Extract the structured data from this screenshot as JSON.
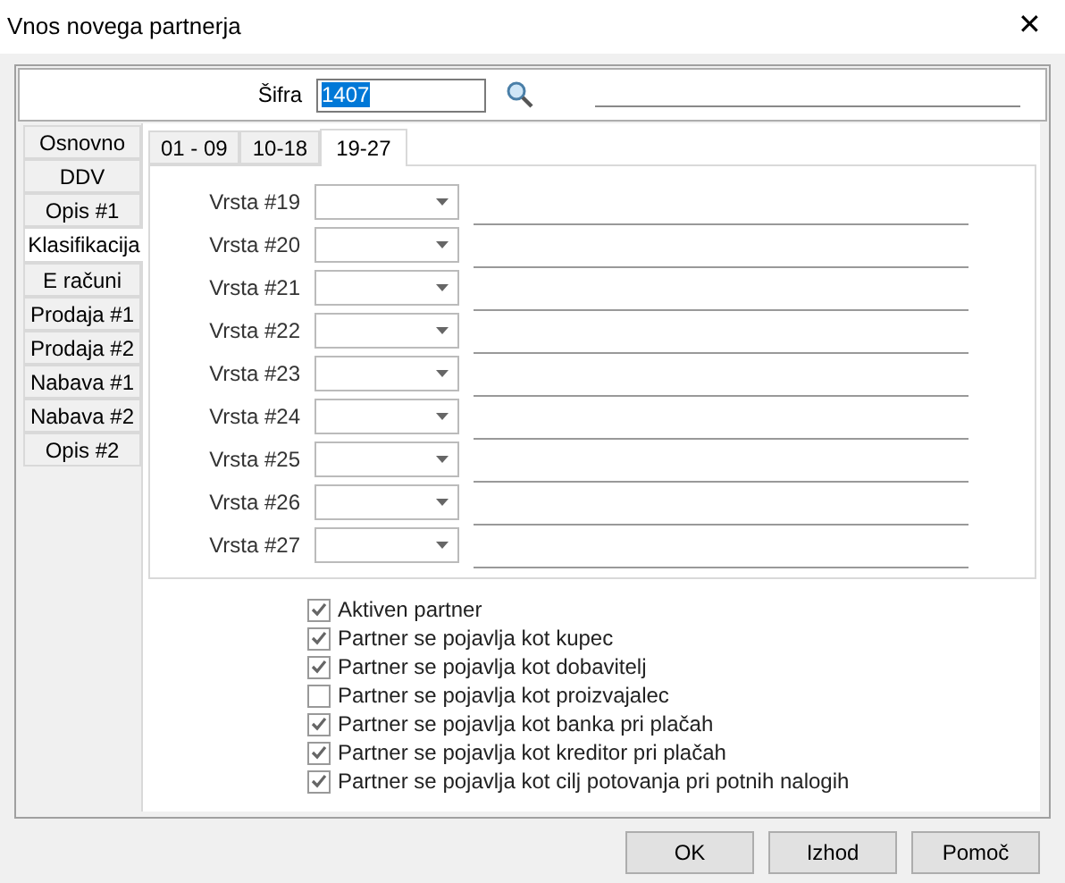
{
  "window": {
    "title": "Vnos novega partnerja",
    "close": "✕"
  },
  "code": {
    "label": "Šifra",
    "value": "1407"
  },
  "side_tabs": [
    {
      "label": "Osnovno",
      "selected": false
    },
    {
      "label": "DDV",
      "selected": false
    },
    {
      "label": "Opis #1",
      "selected": false
    },
    {
      "label": "Klasifikacija",
      "selected": true
    },
    {
      "label": "E računi",
      "selected": false
    },
    {
      "label": "Prodaja #1",
      "selected": false
    },
    {
      "label": "Prodaja #2",
      "selected": false
    },
    {
      "label": "Nabava #1",
      "selected": false
    },
    {
      "label": "Nabava #2",
      "selected": false
    },
    {
      "label": "Opis #2",
      "selected": false
    }
  ],
  "tabs": [
    {
      "label": "01 - 09",
      "selected": false
    },
    {
      "label": "10-18",
      "selected": false
    },
    {
      "label": "19-27",
      "selected": true
    }
  ],
  "rows": [
    {
      "label": "Vrsta #19"
    },
    {
      "label": "Vrsta #20"
    },
    {
      "label": "Vrsta #21"
    },
    {
      "label": "Vrsta #22"
    },
    {
      "label": "Vrsta #23"
    },
    {
      "label": "Vrsta #24"
    },
    {
      "label": "Vrsta #25"
    },
    {
      "label": "Vrsta #26"
    },
    {
      "label": "Vrsta #27"
    }
  ],
  "checkboxes": [
    {
      "label": "Aktiven partner",
      "checked": true
    },
    {
      "label": "Partner se pojavlja kot kupec",
      "checked": true
    },
    {
      "label": "Partner se pojavlja kot dobavitelj",
      "checked": true
    },
    {
      "label": "Partner se pojavlja kot proizvajalec",
      "checked": false
    },
    {
      "label": "Partner se pojavlja kot banka pri plačah",
      "checked": true
    },
    {
      "label": "Partner se pojavlja kot kreditor pri plačah",
      "checked": true
    },
    {
      "label": "Partner se pojavlja kot cilj potovanja pri potnih nalogih",
      "checked": true
    }
  ],
  "buttons": [
    "OK",
    "Izhod",
    "Pomoč"
  ]
}
